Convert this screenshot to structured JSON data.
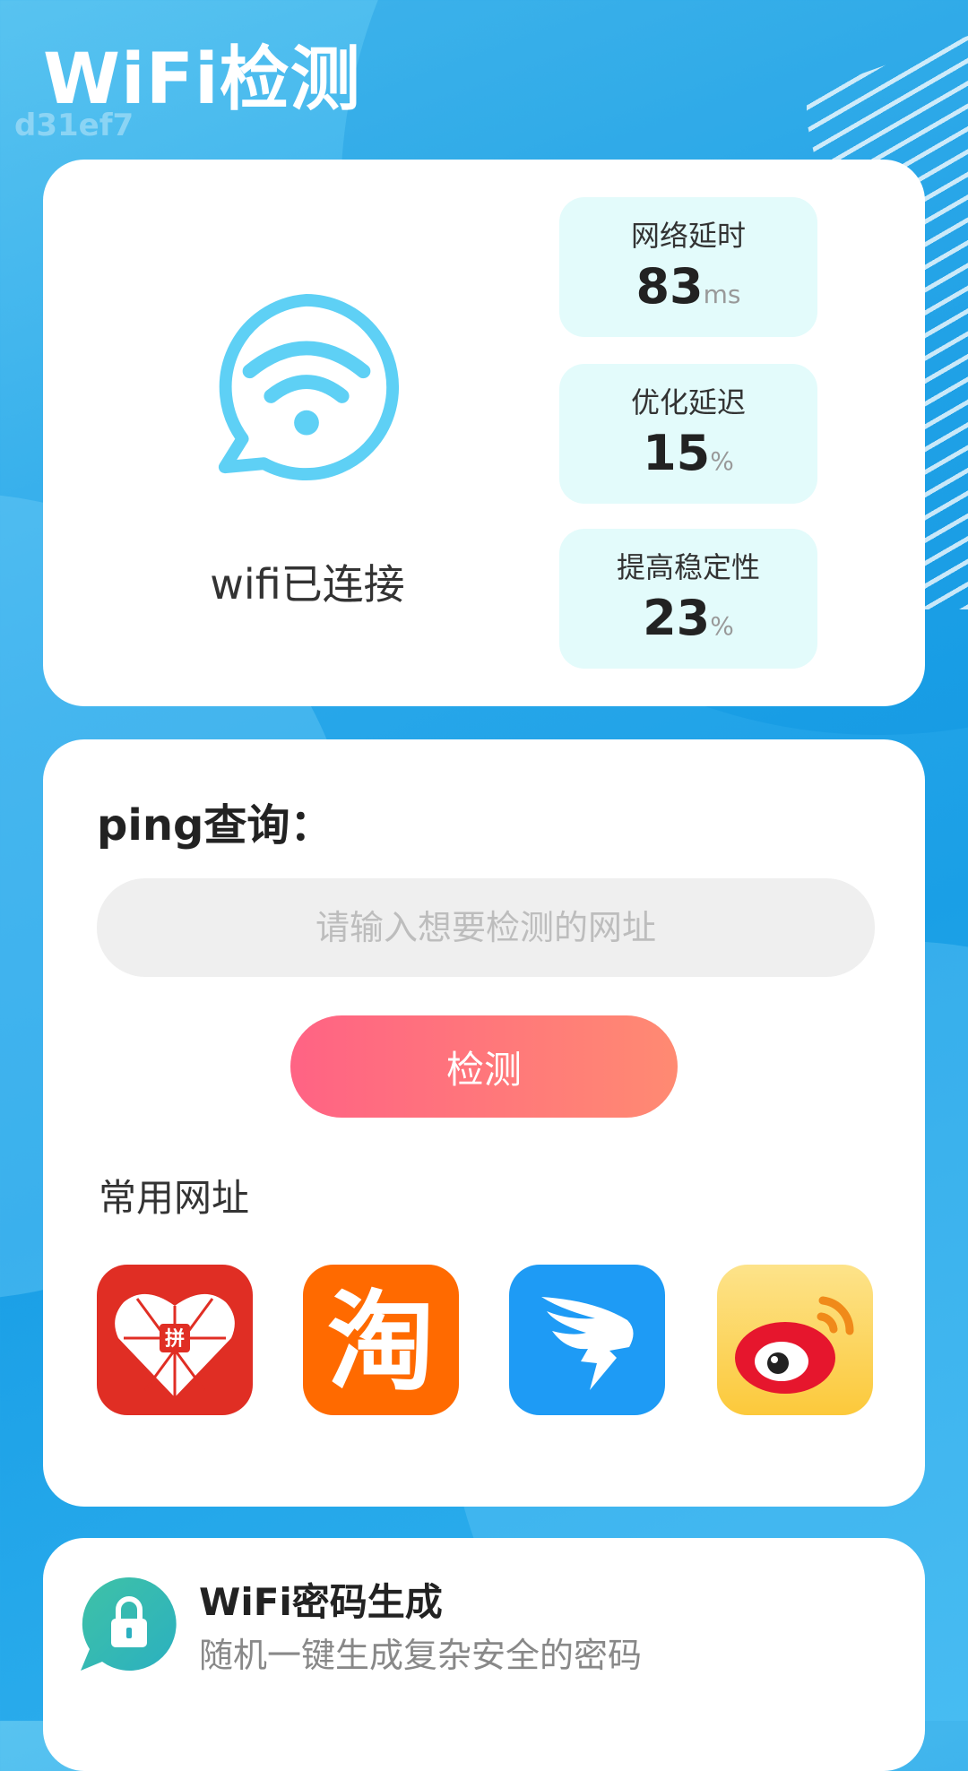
{
  "header": {
    "title": "WiFi检测",
    "code": "d31ef7"
  },
  "status": {
    "wifi_label": "wifi已连接",
    "stats": [
      {
        "label": "网络延时",
        "value": "83",
        "unit": "ms"
      },
      {
        "label": "优化延迟",
        "value": "15",
        "unit": "%"
      },
      {
        "label": "提高稳定性",
        "value": "23",
        "unit": "%"
      }
    ]
  },
  "ping": {
    "title": "ping查询：",
    "placeholder": "请输入想要检测的网址",
    "button_label": "检测",
    "common_title": "常用网址",
    "apps": [
      {
        "icon": "pinduoduo-icon",
        "badge": "拼"
      },
      {
        "icon": "taobao-icon",
        "badge": "淘"
      },
      {
        "icon": "dingtalk-icon"
      },
      {
        "icon": "weibo-icon"
      }
    ]
  },
  "password_gen": {
    "title": "WiFi密码生成",
    "subtitle": "随机一键生成复杂安全的密码"
  },
  "colors": {
    "accent_gradient_start": "#ff6384",
    "accent_gradient_end": "#ff8a72",
    "stat_bg": "#e3fbfb",
    "wifi_icon": "#5ed0f5"
  }
}
